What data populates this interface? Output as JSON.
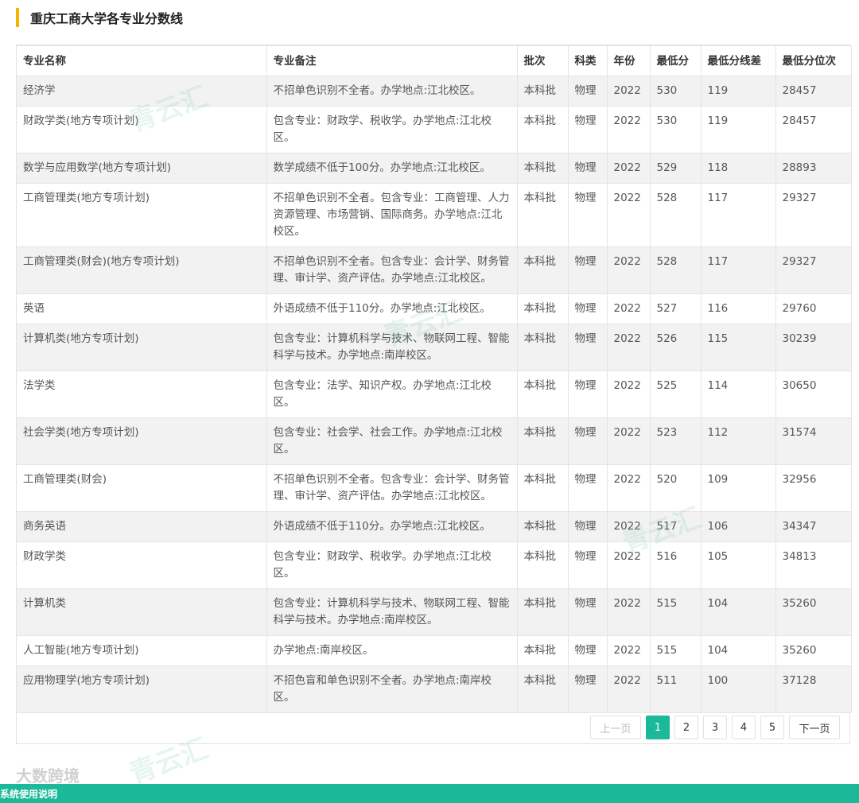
{
  "page_title": "重庆工商大学各专业分数线",
  "table": {
    "headers": [
      "专业名称",
      "专业备注",
      "批次",
      "科类",
      "年份",
      "最低分",
      "最低分线差",
      "最低分位次"
    ],
    "rows": [
      [
        "经济学",
        "不招单色识别不全者。办学地点:江北校区。",
        "本科批",
        "物理",
        "2022",
        "530",
        "119",
        "28457"
      ],
      [
        "财政学类(地方专项计划)",
        "包含专业：财政学、税收学。办学地点:江北校区。",
        "本科批",
        "物理",
        "2022",
        "530",
        "119",
        "28457"
      ],
      [
        "数学与应用数学(地方专项计划)",
        "数学成绩不低于100分。办学地点:江北校区。",
        "本科批",
        "物理",
        "2022",
        "529",
        "118",
        "28893"
      ],
      [
        "工商管理类(地方专项计划)",
        "不招单色识别不全者。包含专业：工商管理、人力资源管理、市场营销、国际商务。办学地点:江北校区。",
        "本科批",
        "物理",
        "2022",
        "528",
        "117",
        "29327"
      ],
      [
        "工商管理类(财会)(地方专项计划)",
        "不招单色识别不全者。包含专业：会计学、财务管理、审计学、资产评估。办学地点:江北校区。",
        "本科批",
        "物理",
        "2022",
        "528",
        "117",
        "29327"
      ],
      [
        "英语",
        "外语成绩不低于110分。办学地点:江北校区。",
        "本科批",
        "物理",
        "2022",
        "527",
        "116",
        "29760"
      ],
      [
        "计算机类(地方专项计划)",
        "包含专业：计算机科学与技术、物联网工程、智能科学与技术。办学地点:南岸校区。",
        "本科批",
        "物理",
        "2022",
        "526",
        "115",
        "30239"
      ],
      [
        "法学类",
        "包含专业：法学、知识产权。办学地点:江北校区。",
        "本科批",
        "物理",
        "2022",
        "525",
        "114",
        "30650"
      ],
      [
        "社会学类(地方专项计划)",
        "包含专业：社会学、社会工作。办学地点:江北校区。",
        "本科批",
        "物理",
        "2022",
        "523",
        "112",
        "31574"
      ],
      [
        "工商管理类(财会)",
        "不招单色识别不全者。包含专业：会计学、财务管理、审计学、资产评估。办学地点:江北校区。",
        "本科批",
        "物理",
        "2022",
        "520",
        "109",
        "32956"
      ],
      [
        "商务英语",
        "外语成绩不低于110分。办学地点:江北校区。",
        "本科批",
        "物理",
        "2022",
        "517",
        "106",
        "34347"
      ],
      [
        "财政学类",
        "包含专业：财政学、税收学。办学地点:江北校区。",
        "本科批",
        "物理",
        "2022",
        "516",
        "105",
        "34813"
      ],
      [
        "计算机类",
        "包含专业：计算机科学与技术、物联网工程、智能科学与技术。办学地点:南岸校区。",
        "本科批",
        "物理",
        "2022",
        "515",
        "104",
        "35260"
      ],
      [
        "人工智能(地方专项计划)",
        "办学地点:南岸校区。",
        "本科批",
        "物理",
        "2022",
        "515",
        "104",
        "35260"
      ],
      [
        "应用物理学(地方专项计划)",
        "不招色盲和单色识别不全者。办学地点:南岸校区。",
        "本科批",
        "物理",
        "2022",
        "511",
        "100",
        "37128"
      ]
    ]
  },
  "pager": {
    "prev_label": "上一页",
    "pages": [
      "1",
      "2",
      "3",
      "4",
      "5"
    ],
    "current": "1",
    "next_label": "下一页"
  },
  "footer": {
    "text": "系统使用说明"
  },
  "watermark": {
    "brand": "青云汇",
    "source": "大数跨境"
  },
  "colors": {
    "accent": "#f6b400",
    "primary": "#1bb99a",
    "stripe": "#f2f2f2"
  }
}
